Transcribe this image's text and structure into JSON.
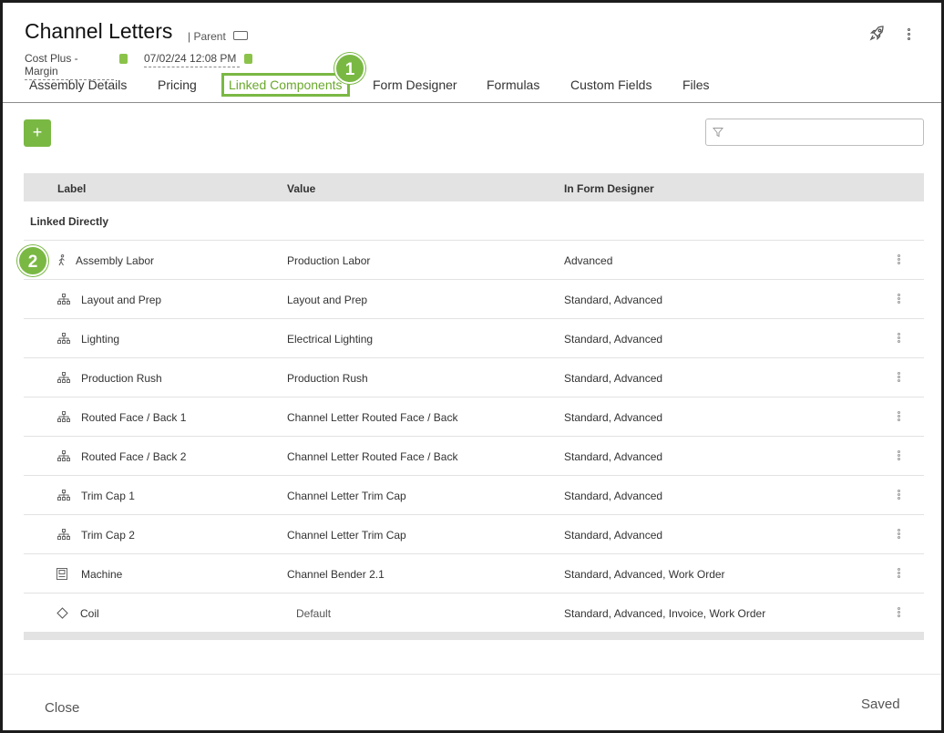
{
  "header": {
    "title": "Channel Letters",
    "parent_label": "| Parent",
    "pricing_method": "Cost Plus - Margin",
    "date": "07/02/24 12:08 PM"
  },
  "tabs": [
    {
      "label": "Assembly Details"
    },
    {
      "label": "Pricing"
    },
    {
      "label": "Linked Components",
      "active": true
    },
    {
      "label": "Form Designer"
    },
    {
      "label": "Formulas"
    },
    {
      "label": "Custom Fields"
    },
    {
      "label": "Files"
    }
  ],
  "callouts": {
    "one": "1",
    "two": "2"
  },
  "toolbar": {
    "add_label": "+"
  },
  "table": {
    "headers": {
      "label": "Label",
      "value": "Value",
      "in_form_designer": "In Form Designer"
    },
    "group": "Linked Directly",
    "rows": [
      {
        "icon": "walking-person-icon",
        "label": "Assembly Labor",
        "value": "Production Labor",
        "forms": "Advanced"
      },
      {
        "icon": "hierarchy-icon",
        "label": "Layout and Prep",
        "value": "Layout and Prep",
        "forms": "Standard, Advanced"
      },
      {
        "icon": "hierarchy-icon",
        "label": "Lighting",
        "value": "Electrical Lighting",
        "forms": "Standard, Advanced"
      },
      {
        "icon": "hierarchy-icon",
        "label": "Production Rush",
        "value": "Production Rush",
        "forms": "Standard, Advanced"
      },
      {
        "icon": "hierarchy-icon",
        "label": "Routed Face / Back 1",
        "value": "Channel Letter Routed Face / Back",
        "forms": "Standard, Advanced"
      },
      {
        "icon": "hierarchy-icon",
        "label": "Routed Face / Back 2",
        "value": "Channel Letter Routed Face / Back",
        "forms": "Standard, Advanced"
      },
      {
        "icon": "hierarchy-icon",
        "label": "Trim Cap 1",
        "value": "Channel Letter Trim Cap",
        "forms": "Standard, Advanced"
      },
      {
        "icon": "hierarchy-icon",
        "label": "Trim Cap 2",
        "value": "Channel Letter Trim Cap",
        "forms": "Standard, Advanced"
      },
      {
        "icon": "machine-icon",
        "label": "Machine",
        "value": "Channel Bender 2.1",
        "forms": "Standard, Advanced, Work Order"
      },
      {
        "icon": "diamond-icon",
        "label": "Coil",
        "value": "Default",
        "forms": "Standard, Advanced, Invoice, Work Order"
      }
    ]
  },
  "footer": {
    "close_label": "Close",
    "status": "Saved"
  },
  "colors": {
    "accent": "#7ab844",
    "header_bg": "#e3e3e3"
  }
}
